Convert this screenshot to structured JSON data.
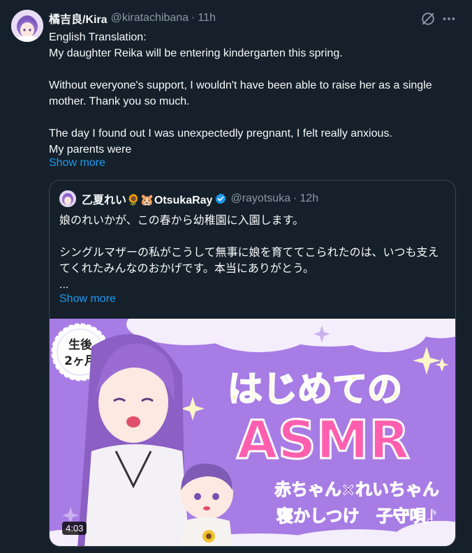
{
  "tweet": {
    "display_name": "橘吉良/Kira",
    "handle": "@kiratachibana",
    "separator": "·",
    "time": "11h",
    "text": "English Translation:\nMy daughter Reika will be entering kindergarten this spring.\n\nWithout everyone's support, I wouldn't have been able to raise her as a single mother. Thank you so much.\n\nThe day I found out I was unexpectedly pregnant, I felt really anxious.\nMy parents were",
    "show_more": "Show more",
    "icons": {
      "avatar": "avatar-anime-girl",
      "grok": "grok-icon",
      "more": "more-options-icon"
    }
  },
  "quote": {
    "display_name": "乙夏れい🌻🐹OtsukaRay",
    "verified_icon": "verified-badge-icon",
    "handle": "@rayotsuka",
    "separator": "·",
    "time": "12h",
    "text": "娘のれいかが、この春から幼稚園に入園します。\n\nシングルマザーの私がこうして無事に娘を育ててこられたのは、いつも支えてくれたみんなのおかげです。本当にありがとう。\n...",
    "show_more": "Show more",
    "media": {
      "badge_line1": "生後",
      "badge_line2": "2ヶ月",
      "title_line1": "はじめての",
      "title_line2": "ASMR",
      "subtitle_line1": "赤ちゃん×れいちゃん",
      "subtitle_line2": "寝かしつけ　子守唄♪",
      "duration": "4:03"
    }
  },
  "colors": {
    "background": "#15202b",
    "text": "#f7f9f9",
    "muted": "#8b98a5",
    "link": "#1d9bf0",
    "border": "#38444d",
    "thumbnail_bg": "#a77ce4",
    "title_yellow": "#ffe97a",
    "title_pink": "#ff5fae"
  }
}
